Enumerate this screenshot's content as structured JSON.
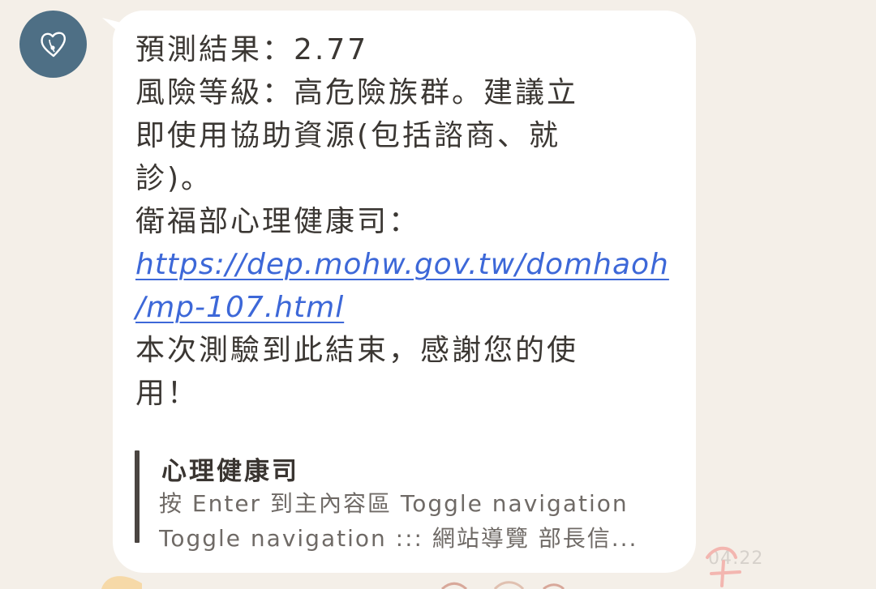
{
  "message": {
    "lines": [
      "預測結果：2.77",
      "風險等級：高危險族群。建議立",
      "即使用協助資源(包括諮商、就",
      "診)。",
      "衛福部心理健康司："
    ],
    "link_lines": [
      "https://dep.mohw.gov.tw/domhaoh",
      "/mp-107.html"
    ],
    "closing_lines": [
      "本次測驗到此結束，感謝您的使",
      "用！"
    ]
  },
  "preview": {
    "title": "心理健康司",
    "desc_lines": [
      "按 Enter 到主內容區 Toggle navigation",
      "Toggle navigation ::: 網站導覽 部長信..."
    ]
  },
  "timestamp": "04:22",
  "colors": {
    "background": "#f4efe8",
    "bubble": "#ffffff",
    "avatar": "#4e6f85",
    "link": "#3d68d8"
  },
  "icons": {
    "avatar": "heart-icon"
  }
}
